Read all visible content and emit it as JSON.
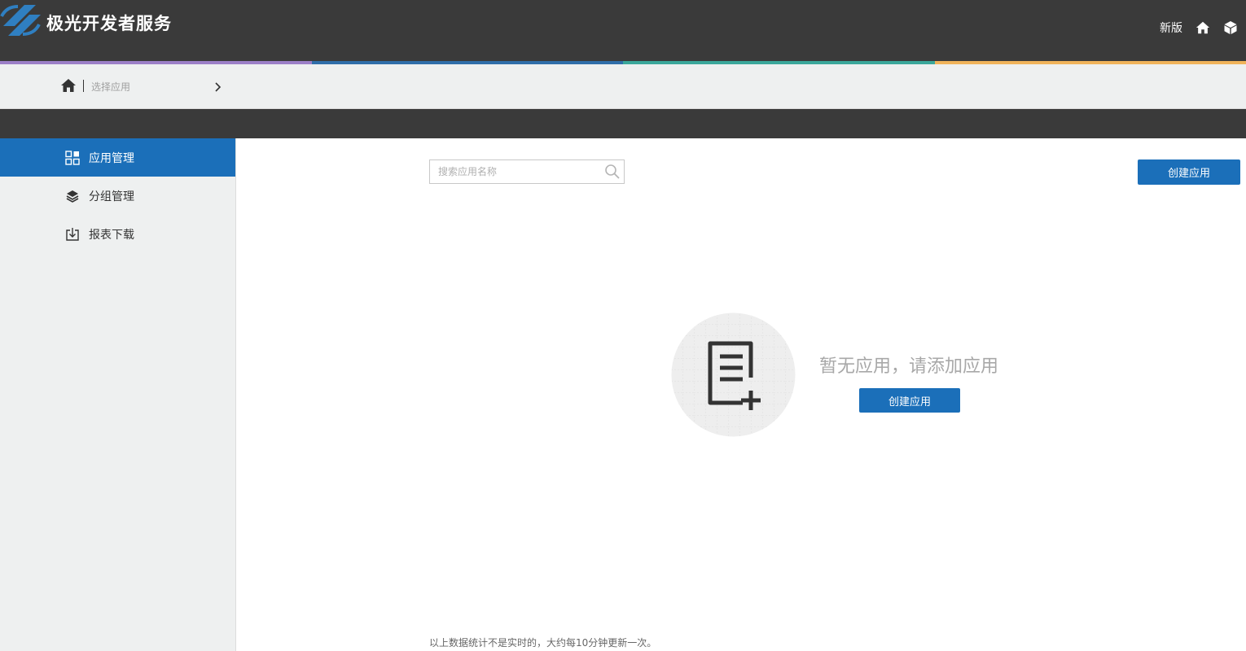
{
  "header": {
    "brand_name": "极光开发者服务",
    "new_version_label": "新版"
  },
  "colors": {
    "header_bg": "#3a3a3a",
    "accent_blue": "#1b6fb9",
    "bar_purple": "#9b7fc7",
    "bar_blue": "#2f6ea9",
    "bar_teal": "#3aa79a",
    "bar_orange": "#f0b35a"
  },
  "breadcrumb": {
    "current": "选择应用"
  },
  "sidebar": {
    "items": [
      {
        "label": "应用管理",
        "icon": "grid-icon",
        "active": true
      },
      {
        "label": "分组管理",
        "icon": "layers-icon",
        "active": false
      },
      {
        "label": "报表下载",
        "icon": "download-icon",
        "active": false
      }
    ]
  },
  "main": {
    "search_placeholder": "搜索应用名称",
    "create_button_label": "创建应用",
    "empty_message": "暂无应用，请添加应用",
    "empty_create_label": "创建应用",
    "footnote": "以上数据统计不是实时的，大约每10分钟更新一次。"
  }
}
